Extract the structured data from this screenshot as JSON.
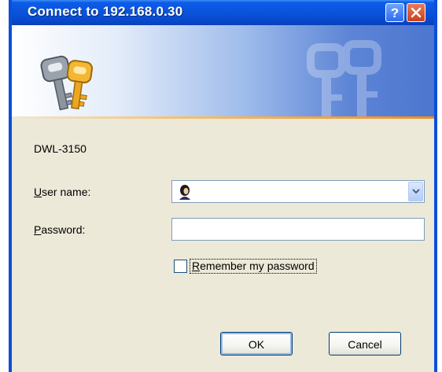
{
  "window": {
    "title": "Connect to 192.168.0.30",
    "help_button": "?",
    "close_button": "X"
  },
  "banner": {
    "icon": "keys-icon",
    "watermark_icon": "keys-watermark-icon"
  },
  "dialog": {
    "device_name": "DWL-3150",
    "username_label_first": "U",
    "username_label_rest": "ser name:",
    "username_value": "",
    "password_label_first": "P",
    "password_label_rest": "assword:",
    "password_value": "",
    "remember_first": "R",
    "remember_rest": "emember my password",
    "remember_checked": false
  },
  "buttons": {
    "ok": "OK",
    "cancel": "Cancel"
  },
  "colors": {
    "titlebar": "#0952D8",
    "dialog_bg": "#ECE9D8",
    "close": "#C8401C",
    "accent_line": "#F08C1C"
  }
}
